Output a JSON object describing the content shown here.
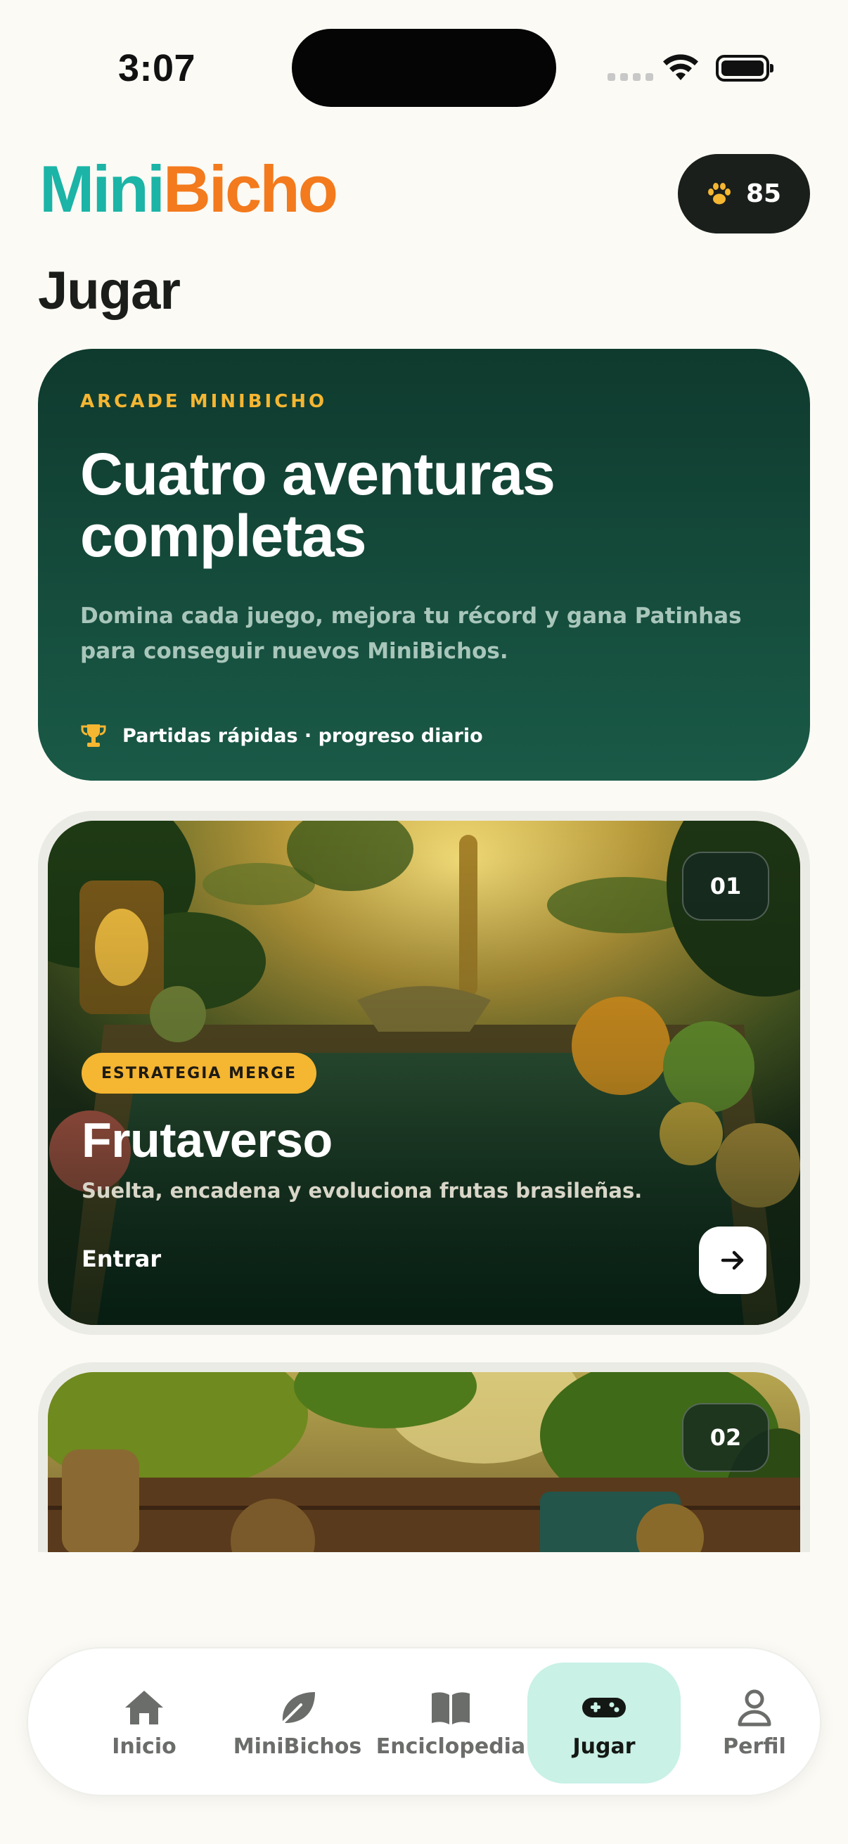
{
  "status_bar": {
    "time": "3:07"
  },
  "header": {
    "logo_part1": "Mini",
    "logo_part2": "Bicho",
    "paw_count": "85",
    "page_title": "Jugar"
  },
  "hero": {
    "kicker": "ARCADE MINIBICHO",
    "title": "Cuatro aventuras completas",
    "description": "Domina cada juego, mejora tu récord y gana Patinhas para conseguir nuevos MiniBichos.",
    "footer": "Partidas rápidas · progreso diario"
  },
  "games": [
    {
      "number": "01",
      "tag": "ESTRATEGIA MERGE",
      "title": "Frutaverso",
      "description": "Suelta, encadena y evoluciona frutas brasileñas.",
      "cta": "Entrar"
    },
    {
      "number": "02"
    }
  ],
  "tabs": [
    {
      "label": "Inicio",
      "icon": "home-icon"
    },
    {
      "label": "MiniBichos",
      "icon": "leaf-icon"
    },
    {
      "label": "Enciclopedia",
      "icon": "book-icon"
    },
    {
      "label": "Jugar",
      "icon": "gamepad-icon",
      "active": true
    },
    {
      "label": "Perfil",
      "icon": "person-icon"
    }
  ],
  "colors": {
    "brand_teal": "#1bb4a6",
    "brand_orange": "#f37a1d",
    "hero_green": "#14473a",
    "accent_yellow": "#f5b632",
    "active_tab": "#c9f1e6"
  }
}
